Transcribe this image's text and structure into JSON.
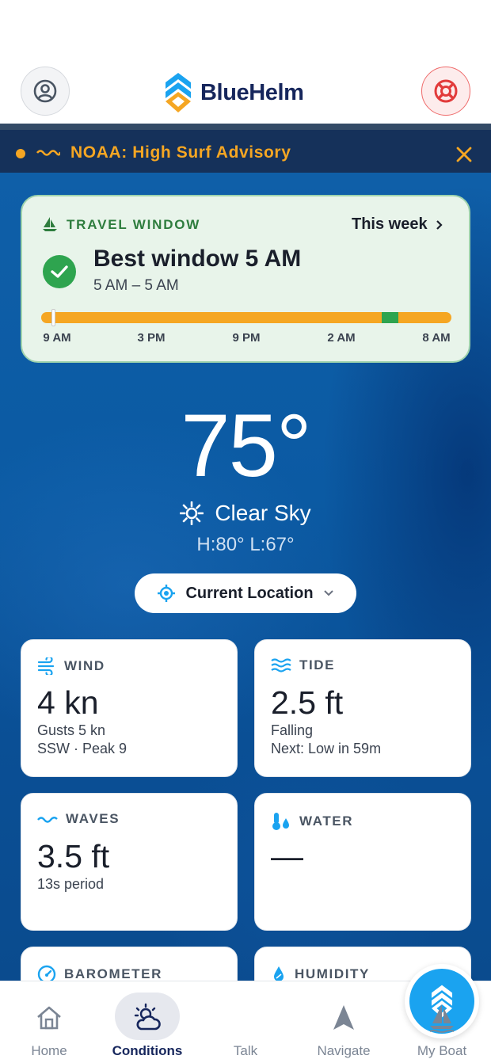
{
  "app": {
    "name": "BlueHelm"
  },
  "alert": {
    "text": "NOAA: High Surf Advisory"
  },
  "travel_window": {
    "label": "TRAVEL WINDOW",
    "range_link": "This week",
    "title": "Best window 5 AM",
    "subtitle": "5 AM – 5 AM",
    "ticks": [
      "9 AM",
      "3 PM",
      "9 PM",
      "2 AM",
      "8 AM"
    ],
    "current_position": 0.025,
    "best_start": 0.83,
    "best_end": 0.87
  },
  "weather": {
    "temperature": "75°",
    "condition": "Clear Sky",
    "hilo": "H:80°  L:67°"
  },
  "location": {
    "label": "Current Location"
  },
  "cards": {
    "wind": {
      "label": "WIND",
      "value": "4 kn",
      "sub1": "Gusts 5 kn",
      "sub2": "SSW · Peak 9"
    },
    "tide": {
      "label": "TIDE",
      "value": "2.5 ft",
      "sub1": "Falling",
      "sub2": "Next: Low in 59m"
    },
    "waves": {
      "label": "WAVES",
      "value": "3.5 ft",
      "sub1": "13s period"
    },
    "water": {
      "label": "WATER",
      "value": "—"
    },
    "barometer": {
      "label": "BAROMETER"
    },
    "humidity": {
      "label": "HUMIDITY"
    }
  },
  "tabs": [
    {
      "label": "Home"
    },
    {
      "label": "Conditions"
    },
    {
      "label": "Talk"
    },
    {
      "label": "Navigate"
    },
    {
      "label": "My Boat"
    }
  ],
  "colors": {
    "brand_navy": "#16265c",
    "brand_blue": "#1aa3f0",
    "alert_orange": "#f5a623",
    "good_green": "#2ea44f",
    "danger_red": "#ef6b6b"
  }
}
